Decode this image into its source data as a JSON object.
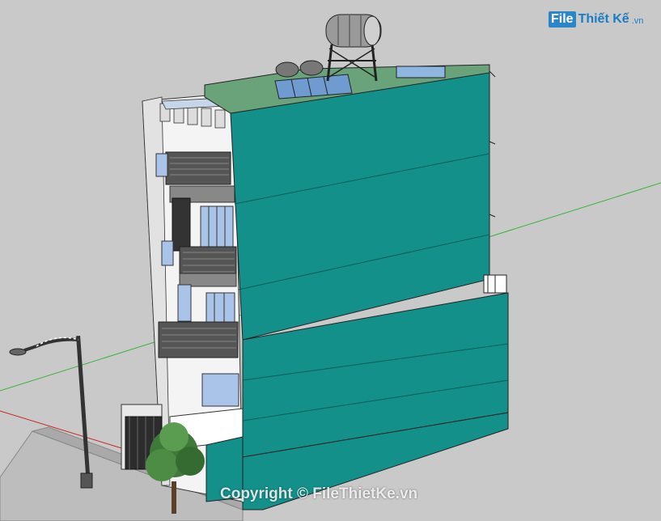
{
  "watermark": {
    "logo_box": "File",
    "logo_text": "Thiết Kế",
    "logo_domain": ".vn"
  },
  "copyright": "Copyright © FileThietKe.vn",
  "colors": {
    "background": "#c9c9c9",
    "facade_teal": "#13908a",
    "wall_white": "#f4f4f4",
    "window_glass": "#a9c4e8",
    "axis_green": "#3bb33b",
    "axis_red": "#cc2222"
  }
}
